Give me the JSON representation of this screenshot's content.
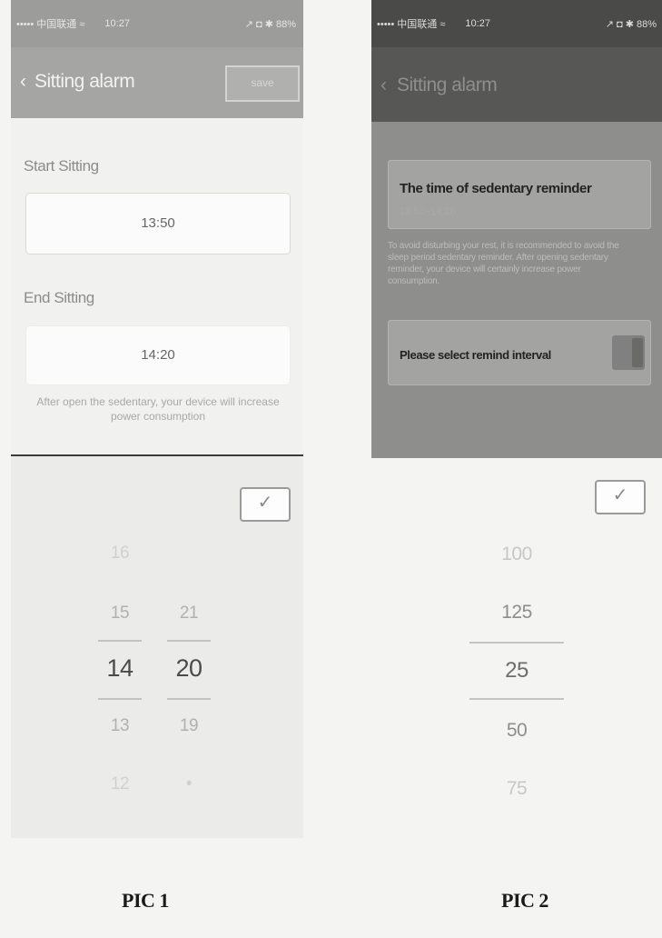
{
  "pic1": {
    "status_bar": {
      "carrier": "•••••  中国联通  ≈",
      "time": "10:27",
      "right": "↗ ◘ ✱ 88%"
    },
    "nav": {
      "back_glyph": "‹",
      "title": "Sitting alarm",
      "save_label": "save"
    },
    "start": {
      "label": "Start Sitting",
      "value": "13:50"
    },
    "end": {
      "label": "End Sitting",
      "value": "14:20"
    },
    "note": "After open the sedentary, your device will increase power consumption",
    "confirm_glyph": "✓",
    "hours": [
      "16",
      "15",
      "14",
      "13",
      "12"
    ],
    "minutes": [
      "21",
      "20",
      "19",
      "•"
    ],
    "selected_hour": "14",
    "selected_minute": "20"
  },
  "pic2": {
    "status_bar": {
      "carrier": "•••••  中国联通  ≈",
      "time": "10:27",
      "right": "↗ ◘ ✱ 88%"
    },
    "nav": {
      "back_glyph": "‹",
      "title": "Sitting alarm"
    },
    "reminder": {
      "title": "The time of sedentary reminder",
      "range": "13:50~14:20"
    },
    "description": "To avoid disturbing your rest, it is recommended to avoid the sleep period sedentary reminder. After opening sedentary reminder, your device will certainly increase power consumption.",
    "interval": {
      "label": "Please select remind interval",
      "enabled": true
    },
    "confirm_glyph": "✓",
    "interval_options": [
      "100",
      "125",
      "25",
      "50",
      "75"
    ],
    "selected_interval": "25"
  },
  "captions": [
    "PIC 1",
    "PIC 2"
  ]
}
